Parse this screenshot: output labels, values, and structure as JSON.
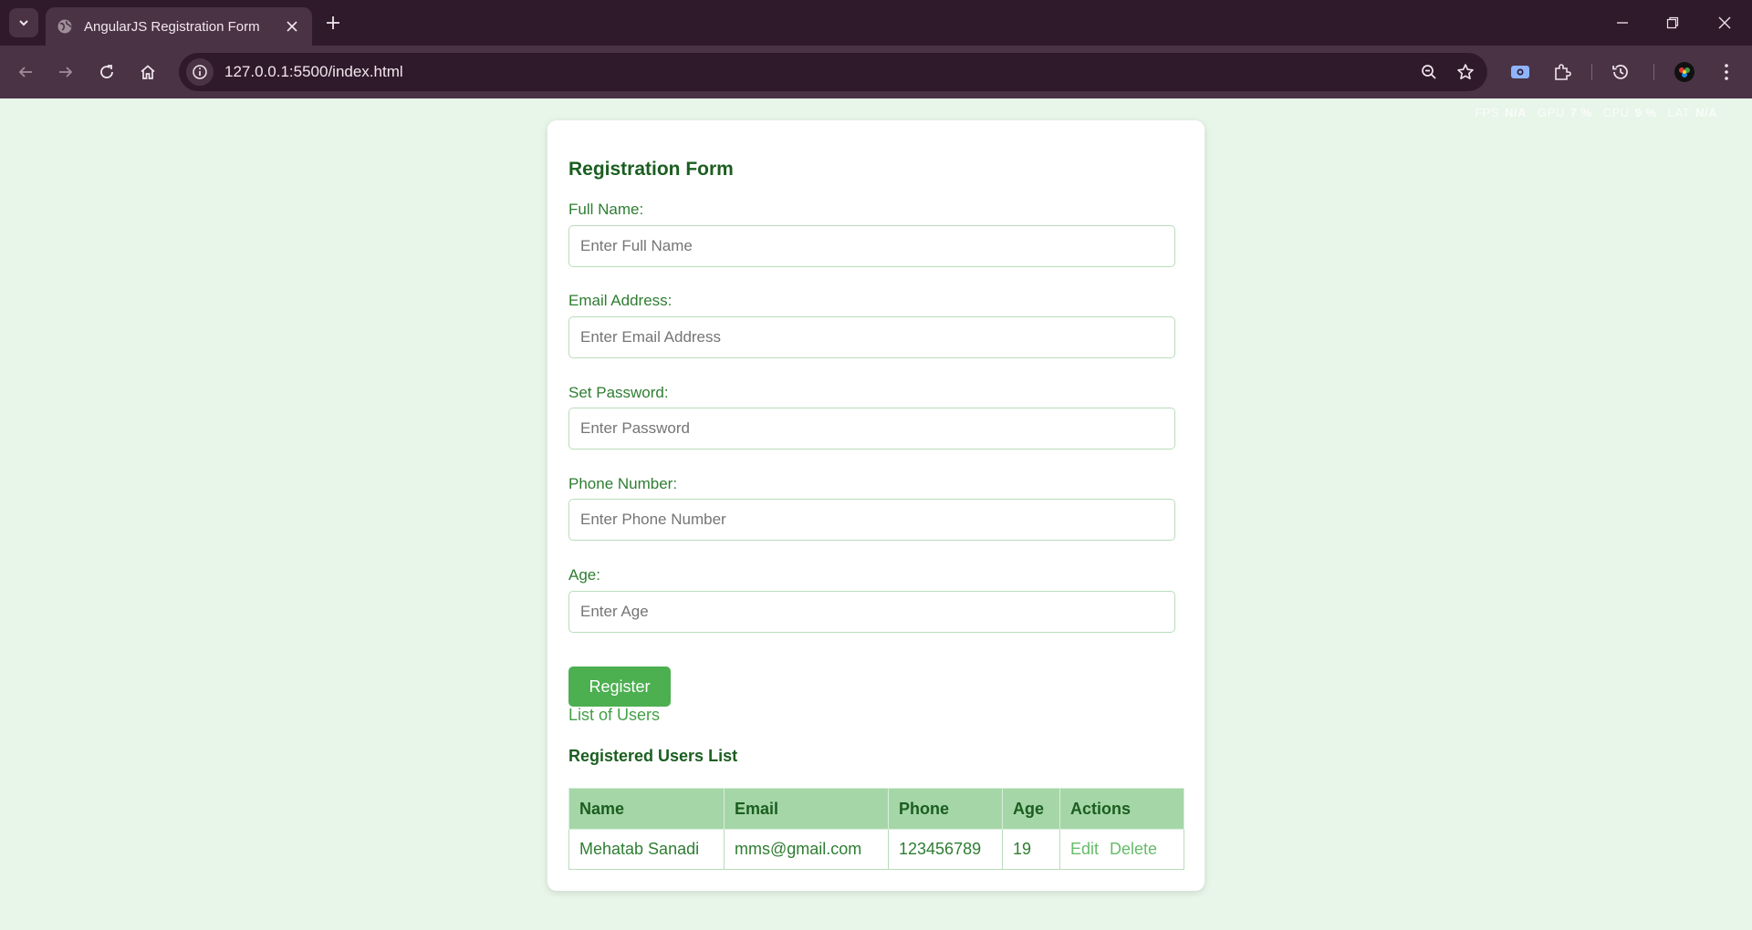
{
  "browser": {
    "tab_title": "AngularJS Registration Form",
    "url": "127.0.0.1:5500/index.html"
  },
  "perf_overlay": {
    "items": [
      {
        "key": "FPS",
        "value": "N/A"
      },
      {
        "key": "GPU",
        "value": "7 %"
      },
      {
        "key": "CPU",
        "value": "9 %"
      },
      {
        "key": "LAT",
        "value": "N/A"
      }
    ]
  },
  "form": {
    "title": "Registration Form",
    "fields": [
      {
        "label": "Full Name:",
        "placeholder": "Enter Full Name",
        "value": ""
      },
      {
        "label": "Email Address:",
        "placeholder": "Enter Email Address",
        "value": ""
      },
      {
        "label": "Set Password:",
        "placeholder": "Enter Password",
        "value": ""
      },
      {
        "label": "Phone Number:",
        "placeholder": "Enter Phone Number",
        "value": ""
      },
      {
        "label": "Age:",
        "placeholder": "Enter Age",
        "value": ""
      }
    ],
    "register_label": "Register"
  },
  "list_link": "List of Users",
  "users": {
    "title": "Registered Users List",
    "columns": [
      "Name",
      "Email",
      "Phone",
      "Age",
      "Actions"
    ],
    "rows": [
      {
        "name": "Mehatab Sanadi",
        "email": "mms@gmail.com",
        "phone": "123456789",
        "age": "19"
      }
    ],
    "edit_label": "Edit",
    "delete_label": "Delete"
  },
  "colors": {
    "page_bg": "#e8f5e9",
    "accent": "#4caf50",
    "heading": "#1b5e20",
    "label": "#2e7d32",
    "table_header": "#a5d6a7"
  }
}
